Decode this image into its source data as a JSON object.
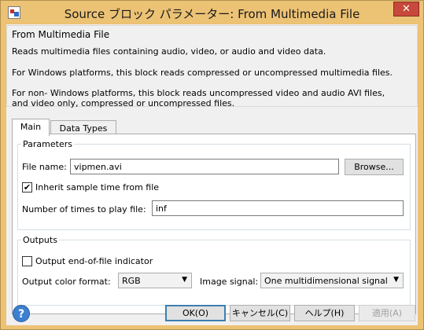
{
  "window": {
    "title": "Source ブロック パラメーター: From Multimedia File",
    "close_glyph": "✕",
    "app_icon": "block-parameters-icon"
  },
  "description": {
    "group_title": "From Multimedia File",
    "lines": [
      "Reads multimedia files containing audio, video, or audio and video data.",
      "For Windows platforms, this block reads compressed or uncompressed multimedia files.",
      "For non- Windows platforms, this block reads uncompressed video and audio AVI files,",
      "and video only, compressed or uncompressed files."
    ]
  },
  "tabs": [
    {
      "label": "Main",
      "active": true
    },
    {
      "label": "Data Types",
      "active": false
    }
  ],
  "parameters": {
    "legend": "Parameters",
    "file_name_label": "File name:",
    "file_name_value": "vipmen.avi",
    "browse_label": "Browse...",
    "inherit_label": "Inherit sample time from file",
    "inherit_checked": true,
    "check_glyph": "✔",
    "times_label": "Number of times to play file:",
    "times_value": "inf"
  },
  "outputs": {
    "legend": "Outputs",
    "eof_label": "Output end-of-file indicator",
    "eof_checked": false,
    "color_format_label": "Output color format:",
    "color_format_value": "RGB",
    "image_signal_label": "Image signal:",
    "image_signal_value": "One multidimensional signal",
    "dropdown_glyph": "▼"
  },
  "footer": {
    "help_glyph": "?",
    "ok_label": "OK(O)",
    "cancel_label": "キャンセル(C)",
    "help_label": "ヘルプ(H)",
    "apply_label": "適用(A)"
  },
  "colors": {
    "title_bar": "#ecc274",
    "close_button": "#c7493b",
    "help_icon": "#3d7fd0"
  }
}
